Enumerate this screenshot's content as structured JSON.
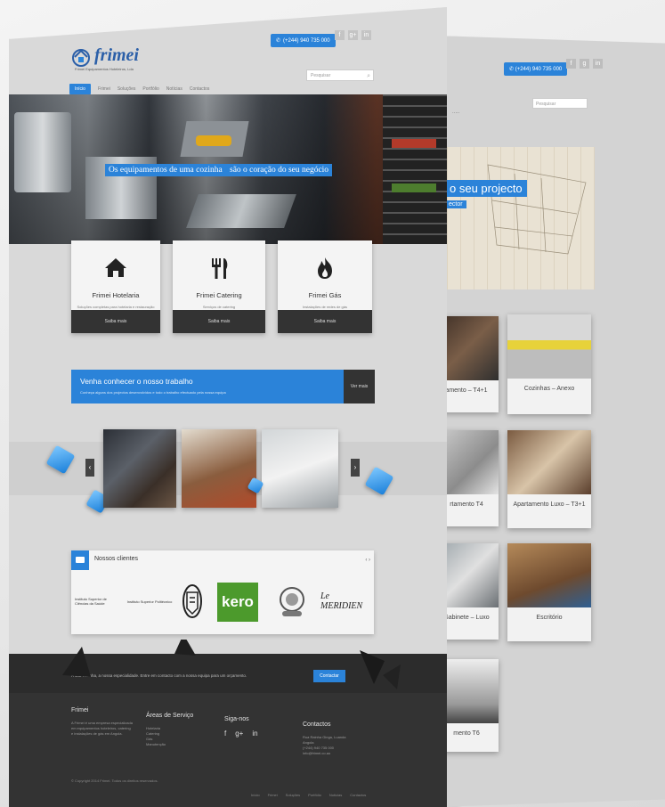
{
  "colors": {
    "accent": "#2b83d9",
    "dark": "#333333",
    "page": "#d9d9d9",
    "kero": "#4c9a2c"
  },
  "back_page": {
    "phone": "(+244) 940 735 000",
    "hero_title": "o seu projecto",
    "hero_sub": "ector",
    "portfolio": [
      {
        "label": "amento – T4+1"
      },
      {
        "label": "Cozinhas – Anexo"
      },
      {
        "label": "rtamento T4"
      },
      {
        "label": "Apartamento Luxo – T3+1"
      },
      {
        "label": "Gabinete – Luxo"
      },
      {
        "label": "Escritório"
      },
      {
        "label": "mento T6"
      }
    ]
  },
  "header": {
    "logo_name": "frimei",
    "logo_sub": "Frimei Equipamentos Hoteleiros, Lda",
    "phone": "(+244) 940 735 000",
    "social": [
      "f",
      "g+",
      "in"
    ],
    "search_placeholder": "Pesquisar",
    "nav": [
      "Início",
      "Frimei",
      "Soluções",
      "Portfólio",
      "Notícias",
      "Contactos"
    ]
  },
  "hero": {
    "caption_1": "Os equipamentos de uma cozinha",
    "caption_2": "são o coração do seu negócio"
  },
  "services": [
    {
      "icon": "house-icon",
      "title": "Frimei Hotelaria",
      "desc": "Soluções completas para hotelaria e restauração",
      "more": "Saiba mais"
    },
    {
      "icon": "cutlery-icon",
      "title": "Frimei Catering",
      "desc": "Serviços de catering",
      "more": "Saiba mais"
    },
    {
      "icon": "flame-icon",
      "title": "Frimei Gás",
      "desc": "Instalações de redes de gás",
      "more": "Saiba mais"
    }
  ],
  "banner": {
    "title": "Venha conhecer o nosso trabalho",
    "subtitle": "Conheça alguns dos projectos desenvolvidos e todo o trabalho efectuado pela nossa equipa",
    "button": "Ver mais"
  },
  "clients": {
    "title": "Nossos clientes",
    "nav": "‹ ›",
    "logo_1": "Instituto Superior de Ciências da Saúde",
    "logo_2": "Instituto Superior Politécnico",
    "logo_4": "kero",
    "logo_6": "Le MERIDIEN"
  },
  "footer": {
    "cta_msg": "A sua cozinha, a nossa especialidade. Entre em contacto com a nossa equipa para um orçamento.",
    "cta_button": "Contactar",
    "col1_title": "Frimei",
    "col1_text": [
      "A Frimei é uma empresa especializada",
      "em equipamentos hoteleiros, catering",
      "e instalações de gás em Angola."
    ],
    "col2_title": "Áreas de Serviço",
    "col2_items": [
      "Hotelaria",
      "Catering",
      "Gás",
      "Manutenção"
    ],
    "col3_title": "Siga-nos",
    "col3_social": [
      "f",
      "g+",
      "in"
    ],
    "col4_title": "Contactos",
    "col4_items": [
      "Rua Rainha Ginga, Luanda",
      "Angola",
      "(+244) 940 735 000",
      "info@frimei.co.ao"
    ],
    "copyright": "© Copyright 2014 Frimei. Todos os direitos reservados.",
    "links": [
      "Início",
      "Frimei",
      "Soluções",
      "Portfólio",
      "Notícias",
      "Contactos"
    ]
  }
}
